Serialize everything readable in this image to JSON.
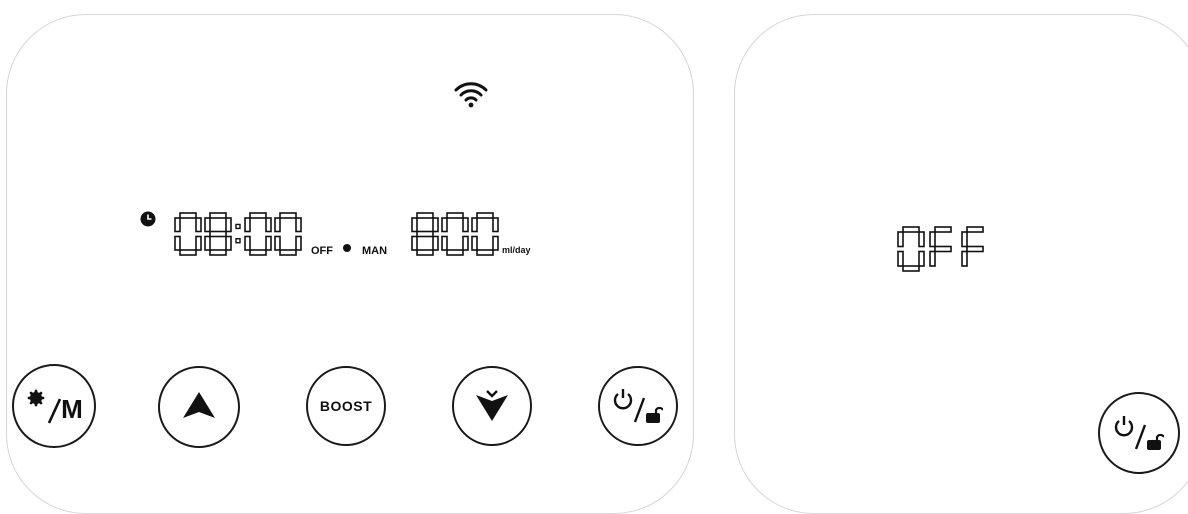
{
  "display": {
    "timer_hours": "08",
    "timer_minutes": "00",
    "timer_state": "OFF",
    "mode": "MAN",
    "rate_value": "800",
    "rate_unit": "ml/day"
  },
  "buttons": {
    "settings_mode_letter": "M",
    "boost_label": "BOOST"
  },
  "status_screen": {
    "state": "OFF"
  },
  "icons": {
    "wifi": "wifi-icon",
    "clock": "clock-icon",
    "gear": "gear-icon",
    "up": "arrow-up-icon",
    "down": "arrow-down-icon",
    "power": "power-icon",
    "lock": "unlock-icon"
  },
  "colors": {
    "segment": "#111111",
    "button_border": "#1a1a1a",
    "panel_border": "#d6d6d6"
  }
}
